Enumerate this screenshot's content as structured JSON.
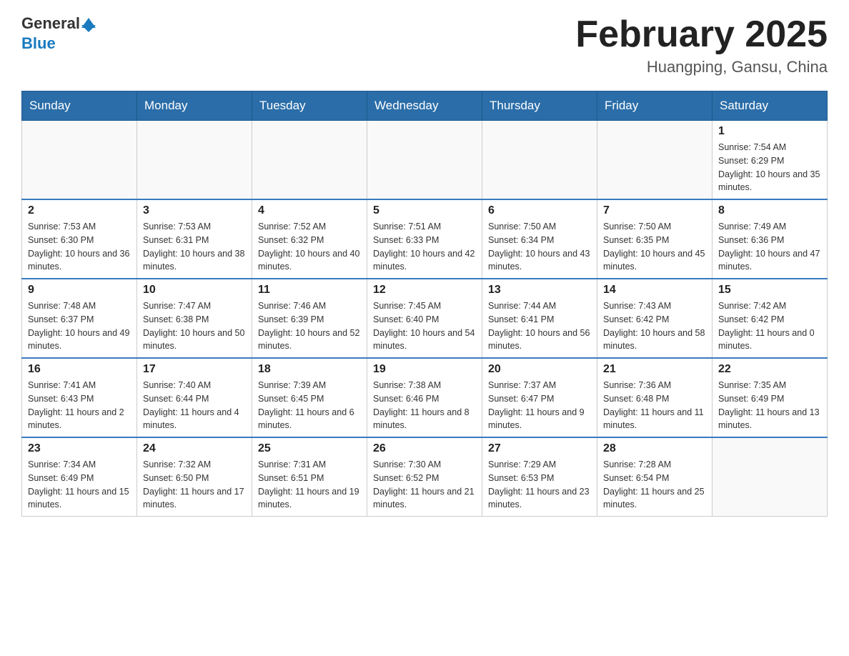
{
  "header": {
    "logo_general": "General",
    "logo_blue": "Blue",
    "title": "February 2025",
    "subtitle": "Huangping, Gansu, China"
  },
  "weekdays": [
    "Sunday",
    "Monday",
    "Tuesday",
    "Wednesday",
    "Thursday",
    "Friday",
    "Saturday"
  ],
  "weeks": [
    [
      {
        "day": "",
        "info": ""
      },
      {
        "day": "",
        "info": ""
      },
      {
        "day": "",
        "info": ""
      },
      {
        "day": "",
        "info": ""
      },
      {
        "day": "",
        "info": ""
      },
      {
        "day": "",
        "info": ""
      },
      {
        "day": "1",
        "info": "Sunrise: 7:54 AM\nSunset: 6:29 PM\nDaylight: 10 hours and 35 minutes."
      }
    ],
    [
      {
        "day": "2",
        "info": "Sunrise: 7:53 AM\nSunset: 6:30 PM\nDaylight: 10 hours and 36 minutes."
      },
      {
        "day": "3",
        "info": "Sunrise: 7:53 AM\nSunset: 6:31 PM\nDaylight: 10 hours and 38 minutes."
      },
      {
        "day": "4",
        "info": "Sunrise: 7:52 AM\nSunset: 6:32 PM\nDaylight: 10 hours and 40 minutes."
      },
      {
        "day": "5",
        "info": "Sunrise: 7:51 AM\nSunset: 6:33 PM\nDaylight: 10 hours and 42 minutes."
      },
      {
        "day": "6",
        "info": "Sunrise: 7:50 AM\nSunset: 6:34 PM\nDaylight: 10 hours and 43 minutes."
      },
      {
        "day": "7",
        "info": "Sunrise: 7:50 AM\nSunset: 6:35 PM\nDaylight: 10 hours and 45 minutes."
      },
      {
        "day": "8",
        "info": "Sunrise: 7:49 AM\nSunset: 6:36 PM\nDaylight: 10 hours and 47 minutes."
      }
    ],
    [
      {
        "day": "9",
        "info": "Sunrise: 7:48 AM\nSunset: 6:37 PM\nDaylight: 10 hours and 49 minutes."
      },
      {
        "day": "10",
        "info": "Sunrise: 7:47 AM\nSunset: 6:38 PM\nDaylight: 10 hours and 50 minutes."
      },
      {
        "day": "11",
        "info": "Sunrise: 7:46 AM\nSunset: 6:39 PM\nDaylight: 10 hours and 52 minutes."
      },
      {
        "day": "12",
        "info": "Sunrise: 7:45 AM\nSunset: 6:40 PM\nDaylight: 10 hours and 54 minutes."
      },
      {
        "day": "13",
        "info": "Sunrise: 7:44 AM\nSunset: 6:41 PM\nDaylight: 10 hours and 56 minutes."
      },
      {
        "day": "14",
        "info": "Sunrise: 7:43 AM\nSunset: 6:42 PM\nDaylight: 10 hours and 58 minutes."
      },
      {
        "day": "15",
        "info": "Sunrise: 7:42 AM\nSunset: 6:42 PM\nDaylight: 11 hours and 0 minutes."
      }
    ],
    [
      {
        "day": "16",
        "info": "Sunrise: 7:41 AM\nSunset: 6:43 PM\nDaylight: 11 hours and 2 minutes."
      },
      {
        "day": "17",
        "info": "Sunrise: 7:40 AM\nSunset: 6:44 PM\nDaylight: 11 hours and 4 minutes."
      },
      {
        "day": "18",
        "info": "Sunrise: 7:39 AM\nSunset: 6:45 PM\nDaylight: 11 hours and 6 minutes."
      },
      {
        "day": "19",
        "info": "Sunrise: 7:38 AM\nSunset: 6:46 PM\nDaylight: 11 hours and 8 minutes."
      },
      {
        "day": "20",
        "info": "Sunrise: 7:37 AM\nSunset: 6:47 PM\nDaylight: 11 hours and 9 minutes."
      },
      {
        "day": "21",
        "info": "Sunrise: 7:36 AM\nSunset: 6:48 PM\nDaylight: 11 hours and 11 minutes."
      },
      {
        "day": "22",
        "info": "Sunrise: 7:35 AM\nSunset: 6:49 PM\nDaylight: 11 hours and 13 minutes."
      }
    ],
    [
      {
        "day": "23",
        "info": "Sunrise: 7:34 AM\nSunset: 6:49 PM\nDaylight: 11 hours and 15 minutes."
      },
      {
        "day": "24",
        "info": "Sunrise: 7:32 AM\nSunset: 6:50 PM\nDaylight: 11 hours and 17 minutes."
      },
      {
        "day": "25",
        "info": "Sunrise: 7:31 AM\nSunset: 6:51 PM\nDaylight: 11 hours and 19 minutes."
      },
      {
        "day": "26",
        "info": "Sunrise: 7:30 AM\nSunset: 6:52 PM\nDaylight: 11 hours and 21 minutes."
      },
      {
        "day": "27",
        "info": "Sunrise: 7:29 AM\nSunset: 6:53 PM\nDaylight: 11 hours and 23 minutes."
      },
      {
        "day": "28",
        "info": "Sunrise: 7:28 AM\nSunset: 6:54 PM\nDaylight: 11 hours and 25 minutes."
      },
      {
        "day": "",
        "info": ""
      }
    ]
  ]
}
